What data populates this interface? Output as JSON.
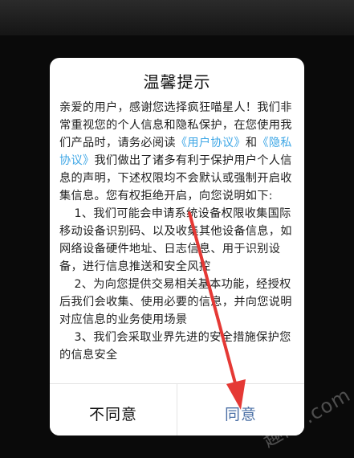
{
  "dialog": {
    "title": "温馨提示",
    "intro_part1": "亲爱的用户，感谢您选择疯狂喵星人！我们非常重视您的个人信息和隐私保护，在您使用我们产品时，请务必阅读",
    "user_agreement_link": "《用户协议》",
    "and": "和",
    "privacy_link": "《隐私协议》",
    "intro_part2": "我们做出了诸多有利于保护用户个人信息的声明，下述权限均不会默认或强制开启收集信息。您有权拒绝开启，向您说明如下:",
    "item1": "1、我们可能会申请系统设备权限收集国际移动设备识别码、以及收集其他设备信息，如网络设备硬件地址、日志信息、用于识别设备，进行信息推送和安全风控",
    "item2": "2、为向您提供交易相关基本功能，经授权后我们会收集、使用必要的信息，并向您说明对应信息的业务使用场景",
    "item3": "3、我们会采取业界先进的安全措施保护您的信息安全",
    "disagree_label": "不同意",
    "agree_label": "同意"
  },
  "colors": {
    "link": "#3fa7e6",
    "agree": "#4a6fa5",
    "arrow": "#e53935"
  },
  "icons": {
    "annotation": "red-arrow-icon"
  }
}
